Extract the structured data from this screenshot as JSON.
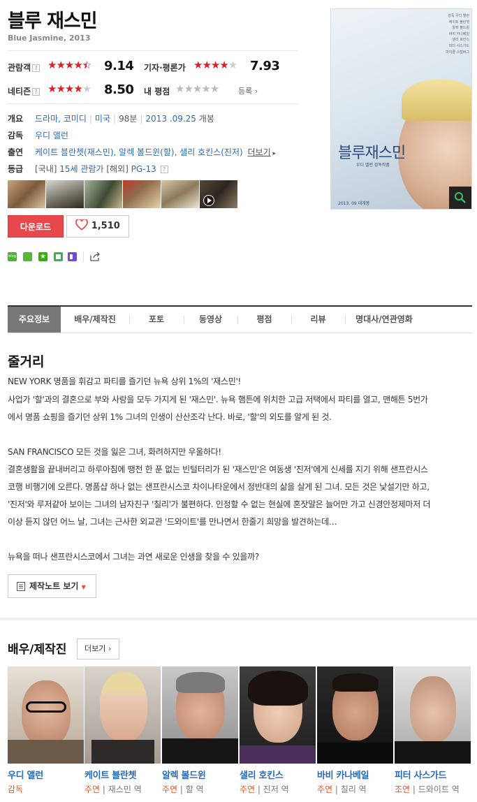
{
  "movie": {
    "title": "블루 재스민",
    "subtitle": "Blue Jasmine, 2013"
  },
  "ratings": {
    "audience": {
      "label": "관람객",
      "help": "?",
      "stars_filled": 4.5,
      "score": "9.14"
    },
    "critics": {
      "label": "기자·평론가",
      "stars_filled": 4,
      "score": "7.93"
    },
    "netizen": {
      "label": "네티즌",
      "help": "?",
      "stars_filled": 4,
      "score": "8.50"
    },
    "my": {
      "label": "내 평점",
      "stars_filled": 0,
      "link": "등록"
    }
  },
  "info": {
    "overview_label": "개요",
    "genre": "드라마, 코미디",
    "country": "미국",
    "runtime": "98분",
    "release_date": "2013 .09.25",
    "release_suffix": "개봉",
    "director_label": "감독",
    "director": "우디 앨런",
    "cast_label": "출연",
    "cast_line": "케이트 블란쳇(재스민), 알렉 볼드윈(할), 샐리 호킨스(진저)",
    "cast_more": "더보기",
    "rating_label": "등급",
    "rating_domestic_tag": "[국내]",
    "rating_domestic": "15세 관람가",
    "rating_overseas_tag": "[해외]",
    "rating_overseas": "PG-13",
    "rating_help": "?"
  },
  "poster": {
    "title": "블루재스민",
    "subtitle": "우디 앨런 감독작품",
    "date": "2013. 09 대개봉",
    "credits": [
      "감독 우디 앨런",
      "케이트 블란쳇",
      "알렉 볼드윈",
      "바비 카나베일",
      "샐리 호킨스",
      "피터 사스가드",
      "마이클 스털버그"
    ]
  },
  "actions": {
    "download": "다운로드",
    "likes": "1,510"
  },
  "tabs": [
    "주요정보",
    "배우/제작진",
    "포토",
    "동영상",
    "평점",
    "리뷰",
    "명대사/연관영화"
  ],
  "synopsis": {
    "heading": "줄거리",
    "lines": [
      "NEW YORK 명품을 휘감고 파티를 즐기던 뉴욕 상위 1%의 '재스민'!",
      " 사업가 '할'과의 결혼으로 부와 사랑을 모두 가지게 된 '재스민'. 뉴욕 햄튼에 위치한 고급 저택에서 파티를 열고, 맨해튼 5번가",
      "에서 명품 쇼핑을 즐기던 상위 1% 그녀의 인생이 산산조각 난다. 바로, '할'의 외도를 알게 된 것.",
      "",
      " SAN FRANCISCO 모든 것을 잃은 그녀, 화려하지만 우울하다!",
      " 결혼생활을 끝내버리고 하루아침에 땡전 한 푼 없는 빈털터리가 된 '재스민'은 여동생 '진저'에게 신세를 지기 위해 샌프란시스",
      "코행 비행기에 오른다. 명품샵 하나 없는 샌프란시스코 차이나타운에서 정반대의 삶을 살게 된 그녀. 모든 것은 낯설기만 하고,",
      "'진저'와 루저같아 보이는 그녀의 남자친구 '칠리'가 불편하다. 인정할 수 없는 현실에 혼잣말은 늘어만 가고 신경안정제마저 더",
      "이상 듣지 않던 어느 날, 그녀는 근사한 외교관 '드와이트'를 만나면서 한줄기 희망을 발견하는데…",
      "",
      " 뉴욕을 떠나 샌프란시스코에서 그녀는 과연 새로운 인생을 찾을 수 있을까?"
    ],
    "note_button": "제작노트 보기"
  },
  "cast_section": {
    "heading": "배우/제작진",
    "more": "더보기",
    "people": [
      {
        "name": "우디 앨런",
        "role": "감독",
        "character": ""
      },
      {
        "name": "케이트 블란쳇",
        "role": "주연",
        "character": "재스민 역"
      },
      {
        "name": "알렉 볼드윈",
        "role": "주연",
        "character": "할 역"
      },
      {
        "name": "샐리 호킨스",
        "role": "주연",
        "character": "진저 역"
      },
      {
        "name": "바비 카나베일",
        "role": "주연",
        "character": "칠리 역"
      },
      {
        "name": "피터 사스가드",
        "role": "조연",
        "character": "드와이트 역"
      }
    ]
  },
  "colors": {
    "accent_red": "#e8484b",
    "link_blue": "#2a6ab5",
    "star_red": "#e31b23"
  }
}
